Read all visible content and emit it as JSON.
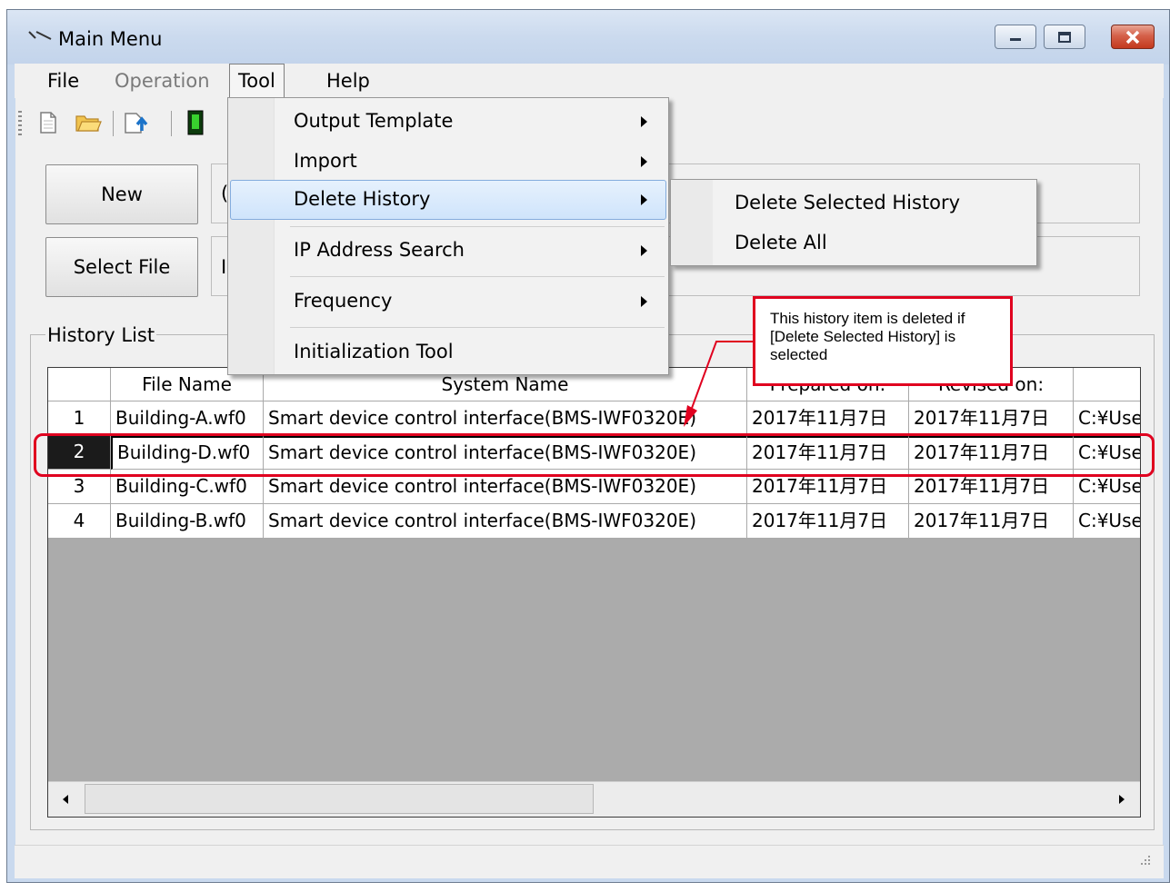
{
  "window": {
    "title": "Main Menu"
  },
  "menubar": {
    "file": "File",
    "operation": "Operation",
    "tool": "Tool",
    "help": "Help"
  },
  "buttons": {
    "new": "New",
    "select_file": "Select File"
  },
  "history": {
    "label": "History List",
    "columns": [
      "",
      "File Name",
      "System Name",
      "Prepared on:",
      "Revised on:",
      ""
    ],
    "rows": [
      {
        "no": "1",
        "file": "Building-A.wf0",
        "system": "Smart device control interface(BMS-IWF0320E)",
        "prepared": "2017年11月7日",
        "revised": "2017年11月7日",
        "path": "C:¥Use"
      },
      {
        "no": "2",
        "file": "Building-D.wf0",
        "system": "Smart device control interface(BMS-IWF0320E)",
        "prepared": "2017年11月7日",
        "revised": "2017年11月7日",
        "path": "C:¥Use"
      },
      {
        "no": "3",
        "file": "Building-C.wf0",
        "system": "Smart device control interface(BMS-IWF0320E)",
        "prepared": "2017年11月7日",
        "revised": "2017年11月7日",
        "path": "C:¥Use"
      },
      {
        "no": "4",
        "file": "Building-B.wf0",
        "system": "Smart device control interface(BMS-IWF0320E)",
        "prepared": "2017年11月7日",
        "revised": "2017年11月7日",
        "path": "C:¥Use"
      }
    ],
    "selected_row": "2"
  },
  "tool_menu": {
    "items": [
      "Output Template",
      "Import",
      "Delete History",
      "IP Address Search",
      "Frequency",
      "Initialization Tool"
    ],
    "highlighted": "Delete History"
  },
  "delete_history_submenu": {
    "items": [
      "Delete Selected History",
      "Delete All"
    ]
  },
  "annotation": {
    "text": "This history item is deleted if [Delete Selected History] is selected"
  },
  "colors": {
    "annotation": "#e0001f",
    "menu_hover": "#cfe4fb",
    "selected_row_header": "#1b1b1b"
  }
}
